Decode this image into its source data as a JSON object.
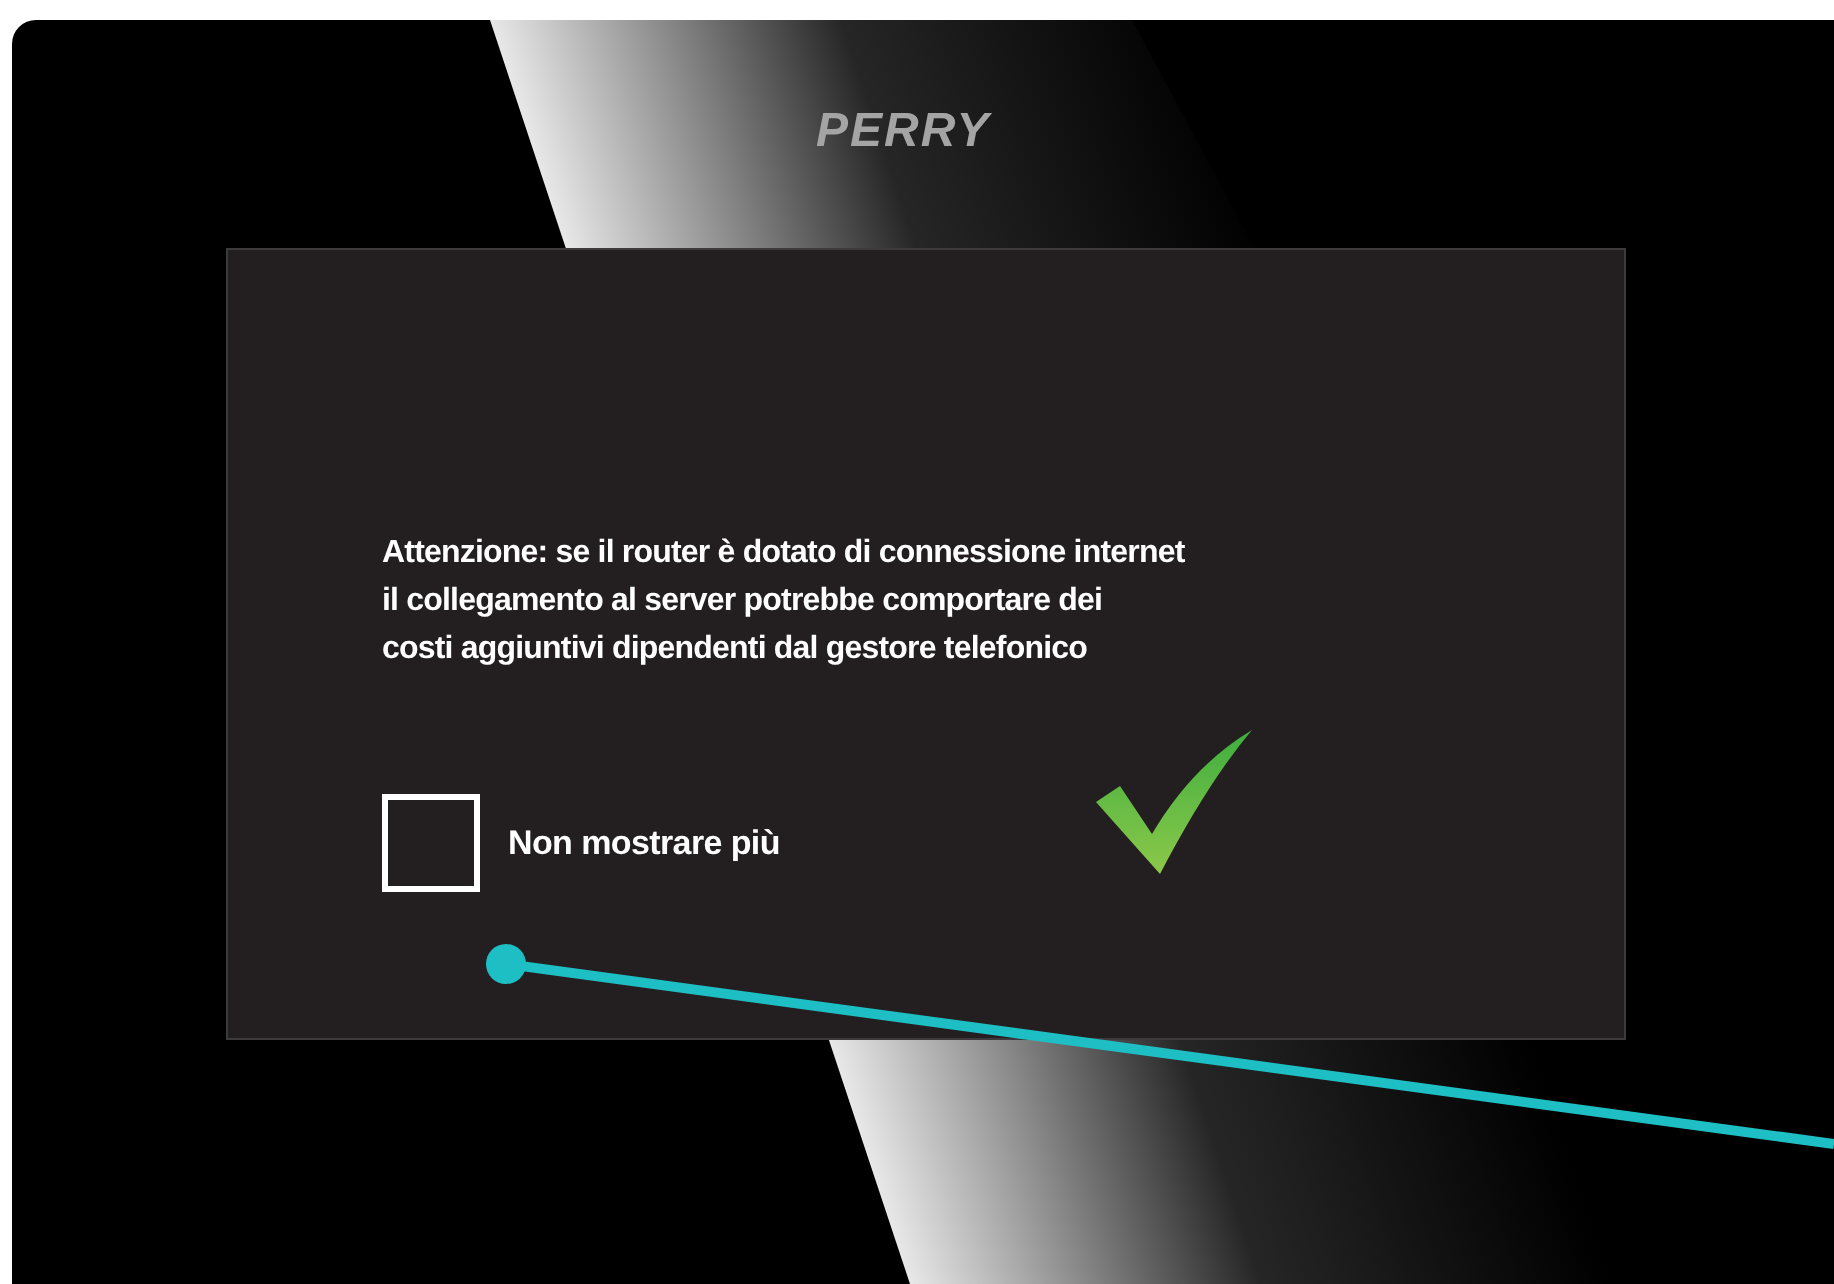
{
  "logo": "PERRY",
  "dialog": {
    "message_lines": [
      "Attenzione: se il router è dotato di connessione internet",
      "il collegamento al server potrebbe comportare dei",
      "costi aggiuntivi dipendenti dal gestore telefonico"
    ],
    "checkbox": {
      "label": "Non mostrare più",
      "checked": false
    }
  }
}
